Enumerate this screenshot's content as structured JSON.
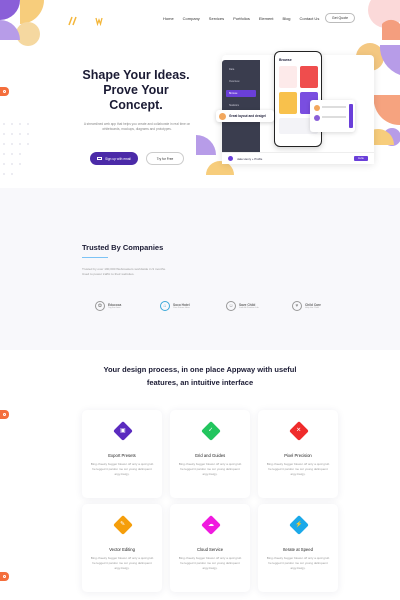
{
  "header": {
    "logo_mark": "//w",
    "nav": [
      "Home",
      "Company",
      "Services",
      "Portfolios",
      "Element",
      "Blog",
      "Contact Us"
    ],
    "cta_label": "Get Quote"
  },
  "hero": {
    "title": "Shape Your Ideas. Prove Your Concept.",
    "description": "A streamlined web app that helps you create and collaborate in real time on whiteboards, mockups, diagrams and prototypes.",
    "primary_button": "Sign up with email",
    "secondary_button": "Try for Free"
  },
  "mockup": {
    "sidebar_items": [
      "Data",
      "Overview",
      "Browse",
      "Statistics",
      "Favorites"
    ],
    "phone_title": "Browse",
    "tooltip": "Great layout and design!",
    "bottom_user": "Jake Henry + Profile",
    "invite_label": "Invite"
  },
  "trusted": {
    "title": "Trusted By Companies",
    "description": "Trusted by over 190,000 Webmasters worldwide in 9 months. Used to power traffic to their websites.",
    "partners": [
      {
        "name": "Educoca",
        "tagline": "Tag line here"
      },
      {
        "name": "Soco Hotel",
        "tagline": "Your Future Here"
      },
      {
        "name": "Save Child",
        "tagline": "Look At Positive Life"
      },
      {
        "name": "Child Care",
        "tagline": "Help the Child"
      }
    ]
  },
  "features": {
    "title": "Your design process, in one place Appway with useful features, an intuitive interface",
    "items": [
      {
        "name": "Export Presets",
        "description": "Bing cheeky bugger blower off only a quid grub he legged it pardon me cor young delinquent argy-bargy.",
        "color": "#5b2bbf",
        "icon": "export-icon"
      },
      {
        "name": "Grid and Guides",
        "description": "Bing cheeky bugger blower off only a quid grub he legged it pardon me cor young delinquent argy-bargy.",
        "color": "#22c55e",
        "icon": "grid-icon"
      },
      {
        "name": "Pixel Precision",
        "description": "Bing cheeky bugger blower off only a quid grub he legged it pardon me cor young delinquent argy-bargy.",
        "color": "#ef2b2b",
        "icon": "crosshair-icon"
      },
      {
        "name": "Vector Editing",
        "description": "Bing cheeky bugger blower off only a quid grub he legged it pardon me cor young delinquent argy-bargy.",
        "color": "#f59e0b",
        "icon": "vector-icon"
      },
      {
        "name": "Cloud Service",
        "description": "Bing cheeky bugger blower off only a quid grub he legged it pardon me cor young delinquent argy-bargy.",
        "color": "#f01adf",
        "icon": "cloud-icon"
      },
      {
        "name": "Iterate at Speed",
        "description": "Bing cheeky bugger blower off only a quid grub he legged it pardon me cor young delinquent argy-bargy.",
        "color": "#1ba9e9",
        "icon": "lightning-icon"
      }
    ]
  }
}
